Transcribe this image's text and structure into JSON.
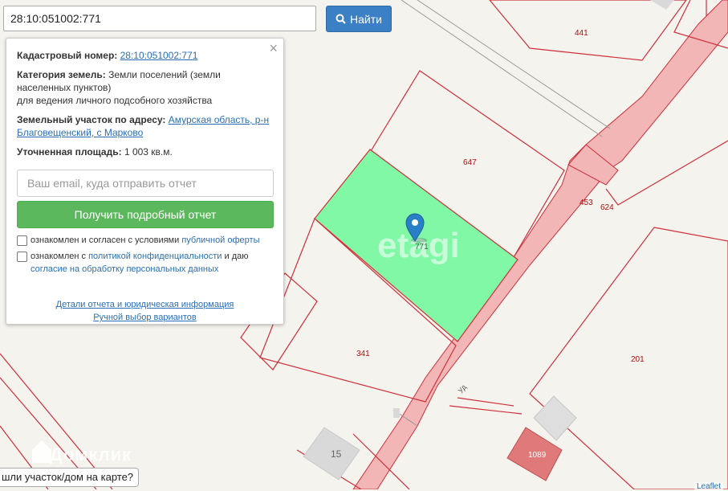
{
  "search": {
    "value": "28:10:051002:771",
    "button_label": "Найти"
  },
  "popup": {
    "cadastral_label": "Кадастровый номер:",
    "cadastral_value": "28:10:051002:771",
    "category_label": "Категория земель:",
    "category_value": "Земли поселений (земли населенных пунктов)",
    "category_use": "для ведения личного подсобного хозяйства",
    "address_label": "Земельный участок по адресу:",
    "address_value": "Амурская область, р-н Благовещенский, с Марково",
    "area_label": "Уточненная площадь:",
    "area_value": "1 003 кв.м.",
    "email_placeholder": "Ваш email, куда отправить отчет",
    "report_button": "Получить подробный отчет",
    "agree1_text": "ознакомлен и согласен с условиями ",
    "agree1_link": "публичной оферты",
    "agree2_text": "ознакомлен с ",
    "agree2_link": "политикой конфиденциальности",
    "agree2_mid": " и даю ",
    "agree2_link2": "согласие на обработку персональных данных",
    "details_link": "Детали отчета и юридическая информация",
    "manual_link": "Ручной выбор вариантов"
  },
  "map": {
    "parcel_labels": {
      "p441": "441",
      "p647": "647",
      "p771": "771",
      "p453": "453",
      "p624": "624",
      "p341": "341",
      "p201": "201",
      "p15": "15",
      "p1089": "1089"
    },
    "road_label": "Уд",
    "watermark": "Домклик",
    "watermark2": "etagi",
    "hint": "шли участок/дом на карте?",
    "attribution": "Leaflet",
    "colors": {
      "boundary": "#d0303a",
      "selected": "#7dfaa8",
      "road": "#f0b0b0",
      "building": "#d8d8d8",
      "marker": "#2a80c8"
    }
  }
}
